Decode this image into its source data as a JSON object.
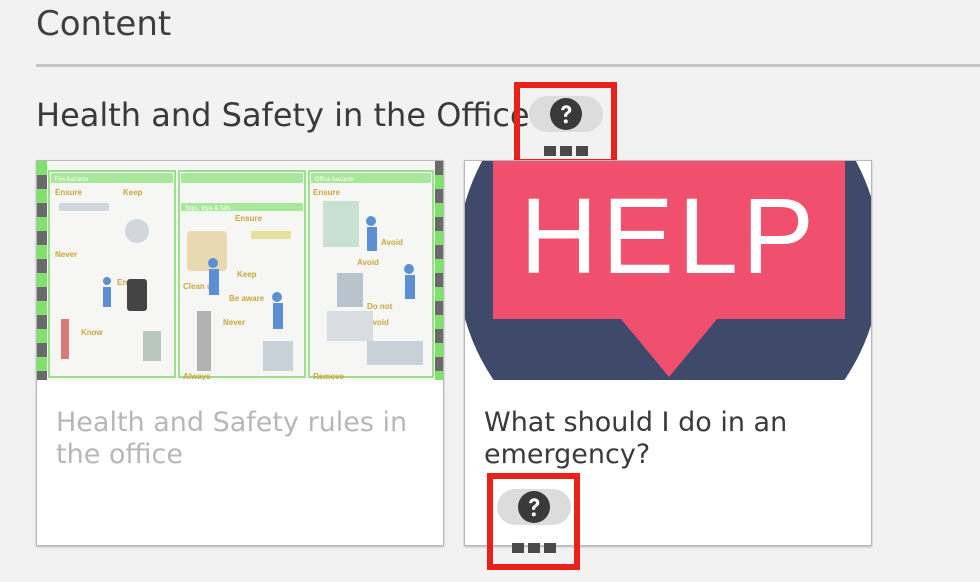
{
  "page": {
    "heading": "Content",
    "section_title": "Health and Safety in the Office"
  },
  "help_widget": {
    "icon": "question-circle-icon",
    "menu_icon": "more-dots-icon",
    "highlight_color": "#e8221b"
  },
  "cards": [
    {
      "title": "Health and Safety rules in the office",
      "thumbnail": "health-and-safety-poster",
      "thumbnail_text": {
        "panel1": "Fire hazards",
        "panel2": "Slips, trips & falls",
        "panel3": "Office hazards",
        "ensure": "Ensure",
        "keep": "Keep",
        "never": "Never",
        "know": "Know",
        "clean_up": "Clean up",
        "be_aware": "Be aware",
        "avoid": "Avoid",
        "do_not": "Do not",
        "always": "Always",
        "remove": "Remove"
      },
      "state": "disabled"
    },
    {
      "title": "What should I do in an emergency?",
      "thumbnail": "help-speech-bubble",
      "thumbnail_text": "HELP",
      "state": "enabled"
    }
  ],
  "colors": {
    "help_bubble": "#f0506e",
    "help_circle": "#3f4a6b",
    "poster_green": "#7fe36a"
  }
}
